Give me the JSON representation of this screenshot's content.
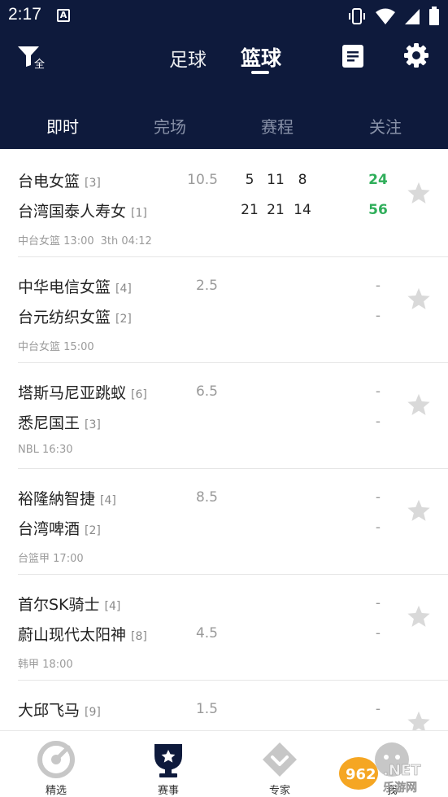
{
  "status_bar": {
    "time": "2:17",
    "a_badge": "A"
  },
  "toolbar": {
    "filter_all_label": "全",
    "sport_tabs": [
      {
        "label": "足球",
        "active": false
      },
      {
        "label": "篮球",
        "active": true
      }
    ]
  },
  "subtabs": [
    {
      "label": "即时",
      "active": true
    },
    {
      "label": "完场",
      "active": false
    },
    {
      "label": "赛程",
      "active": false
    },
    {
      "label": "关注",
      "active": false
    }
  ],
  "matches": [
    {
      "home": {
        "name": "台电女篮",
        "rank": "[3]",
        "quarters": [
          "5",
          "11",
          "8"
        ],
        "total": "24"
      },
      "away": {
        "name": "台湾国泰人寿女",
        "rank": "[1]",
        "quarters": [
          "21",
          "21",
          "14"
        ],
        "total": "56"
      },
      "handicap": "10.5",
      "handicap_row": "home",
      "league": "中台女篮",
      "time": "13:00",
      "clock": "3th 04:12",
      "live": true
    },
    {
      "home": {
        "name": "中华电信女篮",
        "rank": "[4]",
        "quarters": [],
        "total": "-"
      },
      "away": {
        "name": "台元纺织女篮",
        "rank": "[2]",
        "quarters": [],
        "total": "-"
      },
      "handicap": "2.5",
      "handicap_row": "home",
      "league": "中台女篮",
      "time": "15:00",
      "clock": "",
      "live": false
    },
    {
      "home": {
        "name": "塔斯马尼亚跳蚁",
        "rank": "[6]",
        "quarters": [],
        "total": "-"
      },
      "away": {
        "name": "悉尼国王",
        "rank": "[3]",
        "quarters": [],
        "total": "-"
      },
      "handicap": "6.5",
      "handicap_row": "home",
      "league": "NBL",
      "time": "16:30",
      "clock": "",
      "live": false
    },
    {
      "home": {
        "name": "裕隆納智捷",
        "rank": "[4]",
        "quarters": [],
        "total": "-"
      },
      "away": {
        "name": "台湾啤酒",
        "rank": "[2]",
        "quarters": [],
        "total": "-"
      },
      "handicap": "8.5",
      "handicap_row": "home",
      "league": "台篮甲",
      "time": "17:00",
      "clock": "",
      "live": false
    },
    {
      "home": {
        "name": "首尔SK骑士",
        "rank": "[4]",
        "quarters": [],
        "total": "-"
      },
      "away": {
        "name": "蔚山现代太阳神",
        "rank": "[8]",
        "quarters": [],
        "total": "-"
      },
      "handicap": "4.5",
      "handicap_row": "away",
      "league": "韩甲",
      "time": "18:00",
      "clock": "",
      "live": false
    },
    {
      "home": {
        "name": "大邱飞马",
        "rank": "[9]",
        "quarters": [],
        "total": "-"
      },
      "away": {
        "name": "",
        "rank": "",
        "quarters": [],
        "total": ""
      },
      "handicap": "1.5",
      "handicap_row": "home",
      "league": "",
      "time": "",
      "clock": "",
      "live": false
    }
  ],
  "bottom_nav": [
    {
      "label": "精选",
      "icon": "gauge-icon",
      "active": false
    },
    {
      "label": "赛事",
      "icon": "trophy-icon",
      "active": true
    },
    {
      "label": "专家",
      "icon": "diamond-icon",
      "active": false
    },
    {
      "label": "我",
      "icon": "profile-icon",
      "active": false
    }
  ],
  "watermark": {
    "text": "962.NET",
    "subtext": "乐游网"
  },
  "colors": {
    "header_bg": "#0e1a3c",
    "live_score": "#2fae5a",
    "star": "#d9d9d9",
    "nav_icon": "#c7c7c7",
    "nav_active": "#0e1a3c"
  }
}
